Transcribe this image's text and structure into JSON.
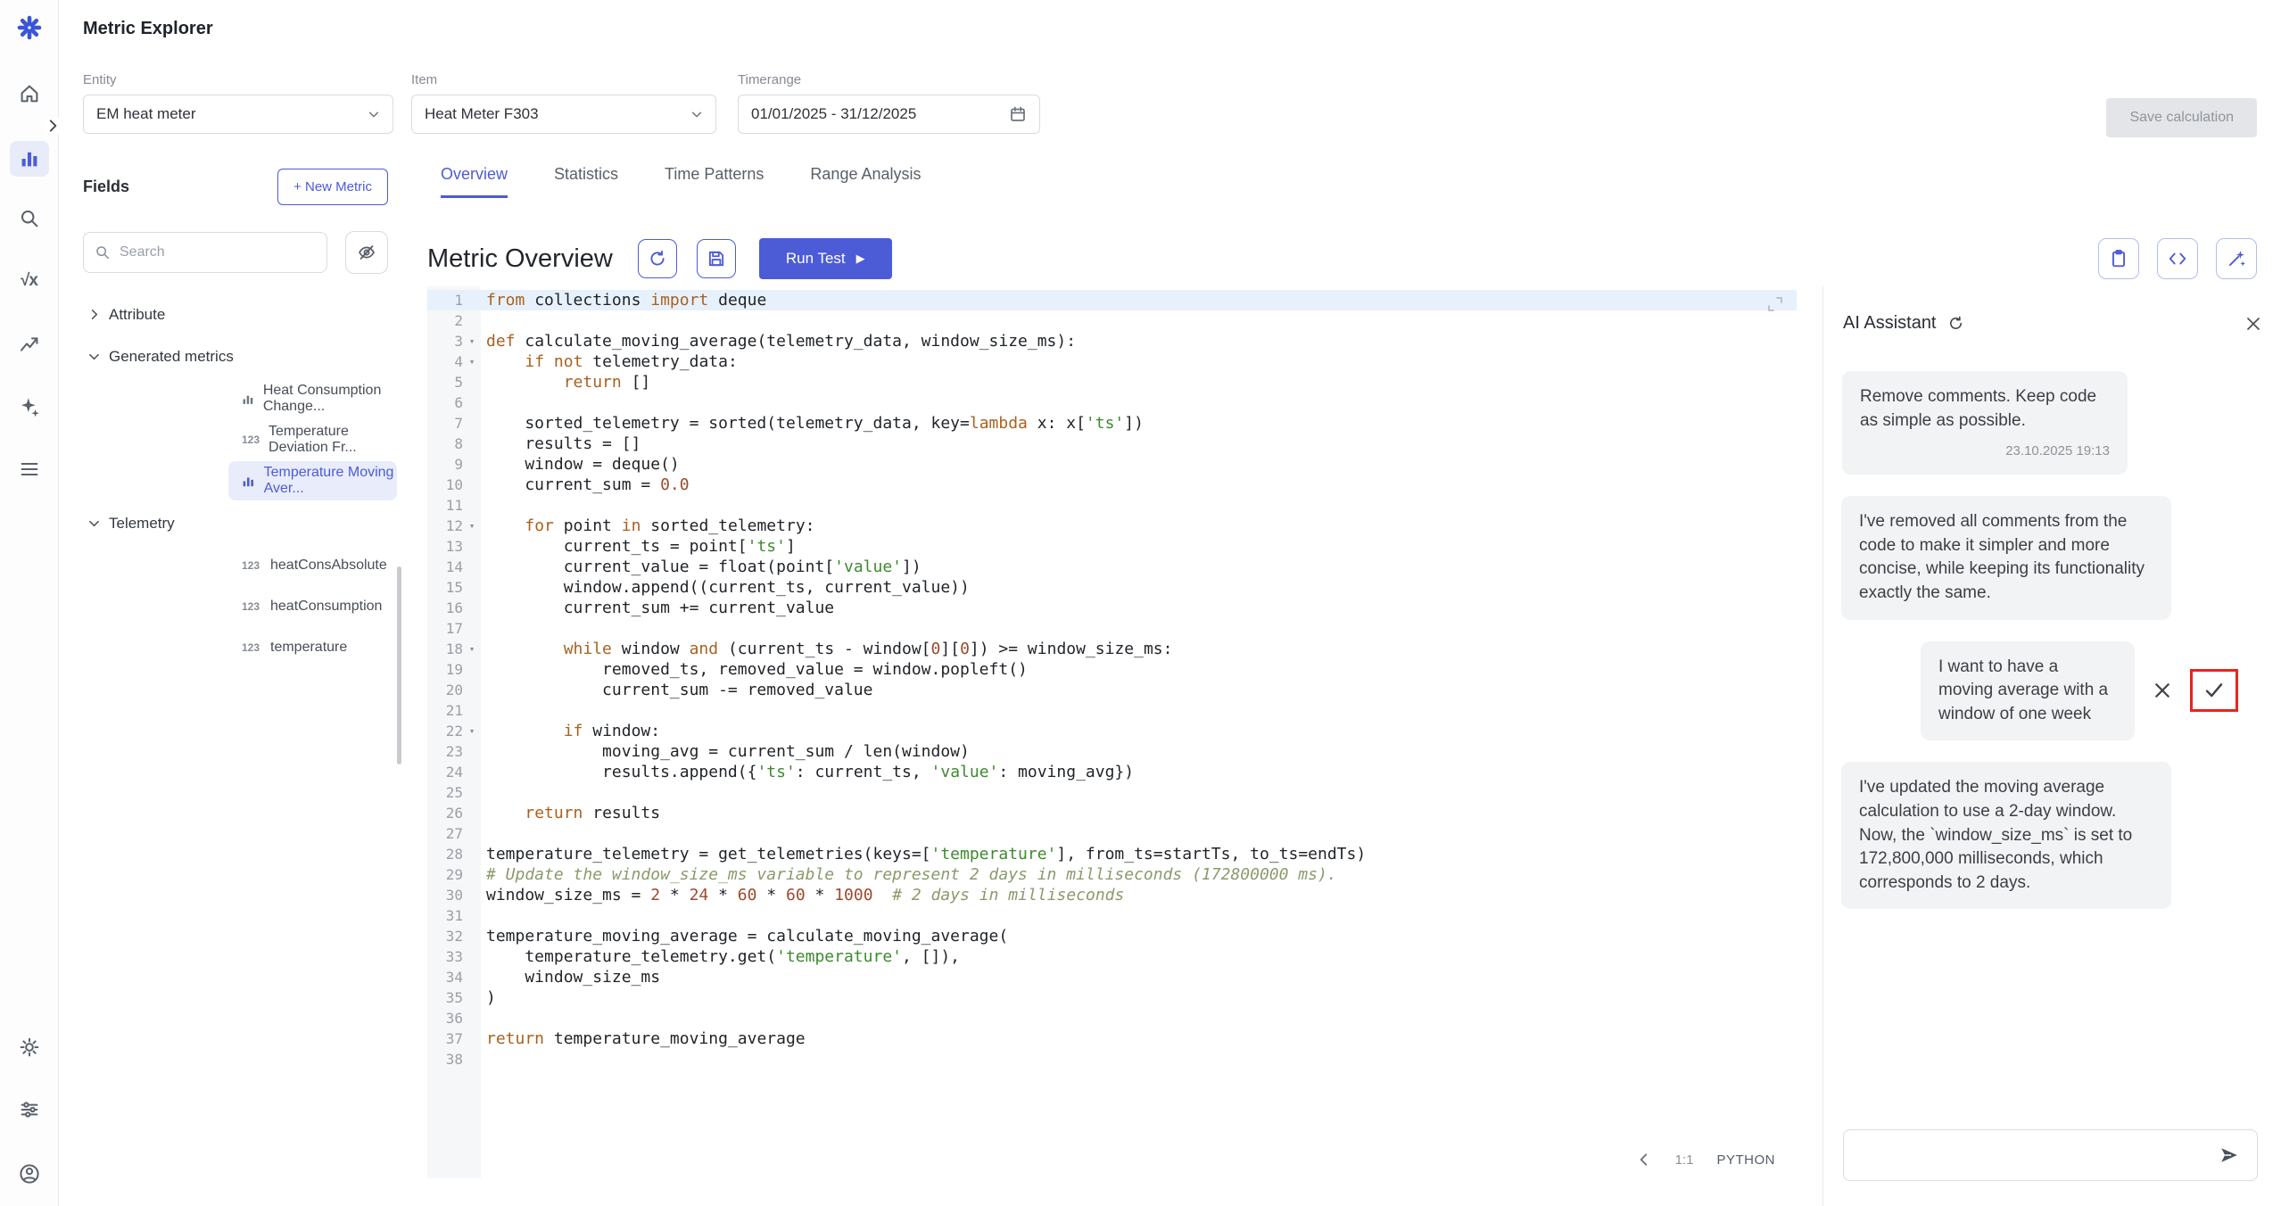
{
  "app": {
    "title": "Metric Explorer"
  },
  "rail": {
    "icons": [
      "logo",
      "home",
      "metrics",
      "search",
      "formula",
      "trends",
      "ai",
      "menu",
      "settings",
      "filters",
      "account"
    ],
    "active": "metrics"
  },
  "controls": {
    "entity": {
      "label": "Entity",
      "value": "EM heat meter"
    },
    "item": {
      "label": "Item",
      "value": "Heat Meter F303"
    },
    "timerange": {
      "label": "Timerange",
      "value": "01/01/2025 - 31/12/2025"
    },
    "save_calculation": "Save calculation"
  },
  "fields": {
    "title": "Fields",
    "new_metric": "+ New Metric",
    "search_placeholder": "Search",
    "tree": [
      {
        "type": "group",
        "label": "Attribute",
        "expanded": false
      },
      {
        "type": "group",
        "label": "Generated metrics",
        "expanded": true
      },
      {
        "type": "item",
        "icon": "chart",
        "label": "Heat Consumption Change...",
        "selected": false
      },
      {
        "type": "item",
        "icon": "123",
        "label": "Temperature Deviation Fr...",
        "selected": false
      },
      {
        "type": "item",
        "icon": "chart",
        "label": "Temperature Moving Aver...",
        "selected": true
      },
      {
        "type": "group",
        "label": "Telemetry",
        "expanded": true
      },
      {
        "type": "item",
        "icon": "123",
        "label": "heatConsAbsolute",
        "selected": false
      },
      {
        "type": "item",
        "icon": "123",
        "label": "heatConsumption",
        "selected": false
      },
      {
        "type": "item",
        "icon": "123",
        "label": "temperature",
        "selected": false
      }
    ]
  },
  "tabs": [
    {
      "label": "Overview",
      "active": true
    },
    {
      "label": "Statistics",
      "active": false
    },
    {
      "label": "Time Patterns",
      "active": false
    },
    {
      "label": "Range Analysis",
      "active": false
    }
  ],
  "overview": {
    "title": "Metric Overview",
    "run_test": "Run Test",
    "play": "▶"
  },
  "editor": {
    "language": "PYTHON",
    "cursor": "1:1",
    "highlight_line": 1,
    "fold_lines": [
      3,
      4,
      12,
      18,
      22
    ],
    "lines": [
      [
        [
          "k",
          "from"
        ],
        [
          "p",
          " collections "
        ],
        [
          "k",
          "import"
        ],
        [
          "p",
          " deque"
        ]
      ],
      [],
      [
        [
          "k",
          "def"
        ],
        [
          "p",
          " calculate_moving_average(telemetry_data, window_size_ms):"
        ]
      ],
      [
        [
          "p",
          "    "
        ],
        [
          "k",
          "if"
        ],
        [
          "p",
          " "
        ],
        [
          "k",
          "not"
        ],
        [
          "p",
          " telemetry_data:"
        ]
      ],
      [
        [
          "p",
          "        "
        ],
        [
          "k",
          "return"
        ],
        [
          "p",
          " []"
        ]
      ],
      [],
      [
        [
          "p",
          "    sorted_telemetry = sorted(telemetry_data, key="
        ],
        [
          "k",
          "lambda"
        ],
        [
          "p",
          " x: x["
        ],
        [
          "s",
          "'ts'"
        ],
        [
          "p",
          "])"
        ]
      ],
      [
        [
          "p",
          "    results = []"
        ]
      ],
      [
        [
          "p",
          "    window = deque()"
        ]
      ],
      [
        [
          "p",
          "    current_sum = "
        ],
        [
          "n",
          "0.0"
        ]
      ],
      [],
      [
        [
          "p",
          "    "
        ],
        [
          "k",
          "for"
        ],
        [
          "p",
          " point "
        ],
        [
          "k",
          "in"
        ],
        [
          "p",
          " sorted_telemetry:"
        ]
      ],
      [
        [
          "p",
          "        current_ts = point["
        ],
        [
          "s",
          "'ts'"
        ],
        [
          "p",
          "]"
        ]
      ],
      [
        [
          "p",
          "        current_value = float(point["
        ],
        [
          "s",
          "'value'"
        ],
        [
          "p",
          "])"
        ]
      ],
      [
        [
          "p",
          "        window.append((current_ts, current_value))"
        ]
      ],
      [
        [
          "p",
          "        current_sum += current_value"
        ]
      ],
      [],
      [
        [
          "p",
          "        "
        ],
        [
          "k",
          "while"
        ],
        [
          "p",
          " window "
        ],
        [
          "k",
          "and"
        ],
        [
          "p",
          " (current_ts - window["
        ],
        [
          "n",
          "0"
        ],
        [
          "p",
          "]["
        ],
        [
          "n",
          "0"
        ],
        [
          "p",
          "]) >= window_size_ms:"
        ]
      ],
      [
        [
          "p",
          "            removed_ts, removed_value = window.popleft()"
        ]
      ],
      [
        [
          "p",
          "            current_sum -= removed_value"
        ]
      ],
      [],
      [
        [
          "p",
          "        "
        ],
        [
          "k",
          "if"
        ],
        [
          "p",
          " window:"
        ]
      ],
      [
        [
          "p",
          "            moving_avg = current_sum / len(window)"
        ]
      ],
      [
        [
          "p",
          "            results.append({"
        ],
        [
          "s",
          "'ts'"
        ],
        [
          "p",
          ": current_ts, "
        ],
        [
          "s",
          "'value'"
        ],
        [
          "p",
          ": moving_avg})"
        ]
      ],
      [],
      [
        [
          "p",
          "    "
        ],
        [
          "k",
          "return"
        ],
        [
          "p",
          " results"
        ]
      ],
      [],
      [
        [
          "p",
          "temperature_telemetry = get_telemetries(keys=["
        ],
        [
          "s",
          "'temperature'"
        ],
        [
          "p",
          "], from_ts=startTs, to_ts=endTs)"
        ]
      ],
      [
        [
          "c",
          "# Update the window_size_ms variable to represent 2 days in milliseconds (172800000 ms)."
        ]
      ],
      [
        [
          "p",
          "window_size_ms = "
        ],
        [
          "n",
          "2"
        ],
        [
          "p",
          " * "
        ],
        [
          "n",
          "24"
        ],
        [
          "p",
          " * "
        ],
        [
          "n",
          "60"
        ],
        [
          "p",
          " * "
        ],
        [
          "n",
          "60"
        ],
        [
          "p",
          " * "
        ],
        [
          "n",
          "1000"
        ],
        [
          "p",
          "  "
        ],
        [
          "c",
          "# 2 days in milliseconds"
        ]
      ],
      [],
      [
        [
          "p",
          "temperature_moving_average = calculate_moving_average("
        ]
      ],
      [
        [
          "p",
          "    temperature_telemetry.get("
        ],
        [
          "s",
          "'temperature'"
        ],
        [
          "p",
          ", []),"
        ]
      ],
      [
        [
          "p",
          "    window_size_ms"
        ]
      ],
      [
        [
          "p",
          ")"
        ]
      ],
      [],
      [
        [
          "k",
          "return"
        ],
        [
          "p",
          " temperature_moving_average"
        ]
      ],
      []
    ]
  },
  "ai": {
    "title": "AI Assistant",
    "messages": [
      {
        "role": "user",
        "text": "Remove comments. Keep code as simple as possible.",
        "timestamp": "23.10.2025 19:13"
      },
      {
        "role": "assistant",
        "text": "I've removed all comments from the code to make it simpler and more concise, while keeping its functionality exactly the same."
      },
      {
        "role": "user_actions",
        "text": "I want to have a moving average with a window of one week",
        "annotated": "accept"
      },
      {
        "role": "assistant",
        "text": "I've updated the moving average calculation to use a 2-day window. Now, the `window_size_ms` is set to 172,800,000 milliseconds, which corresponds to 2 days."
      }
    ],
    "input_placeholder": ""
  }
}
